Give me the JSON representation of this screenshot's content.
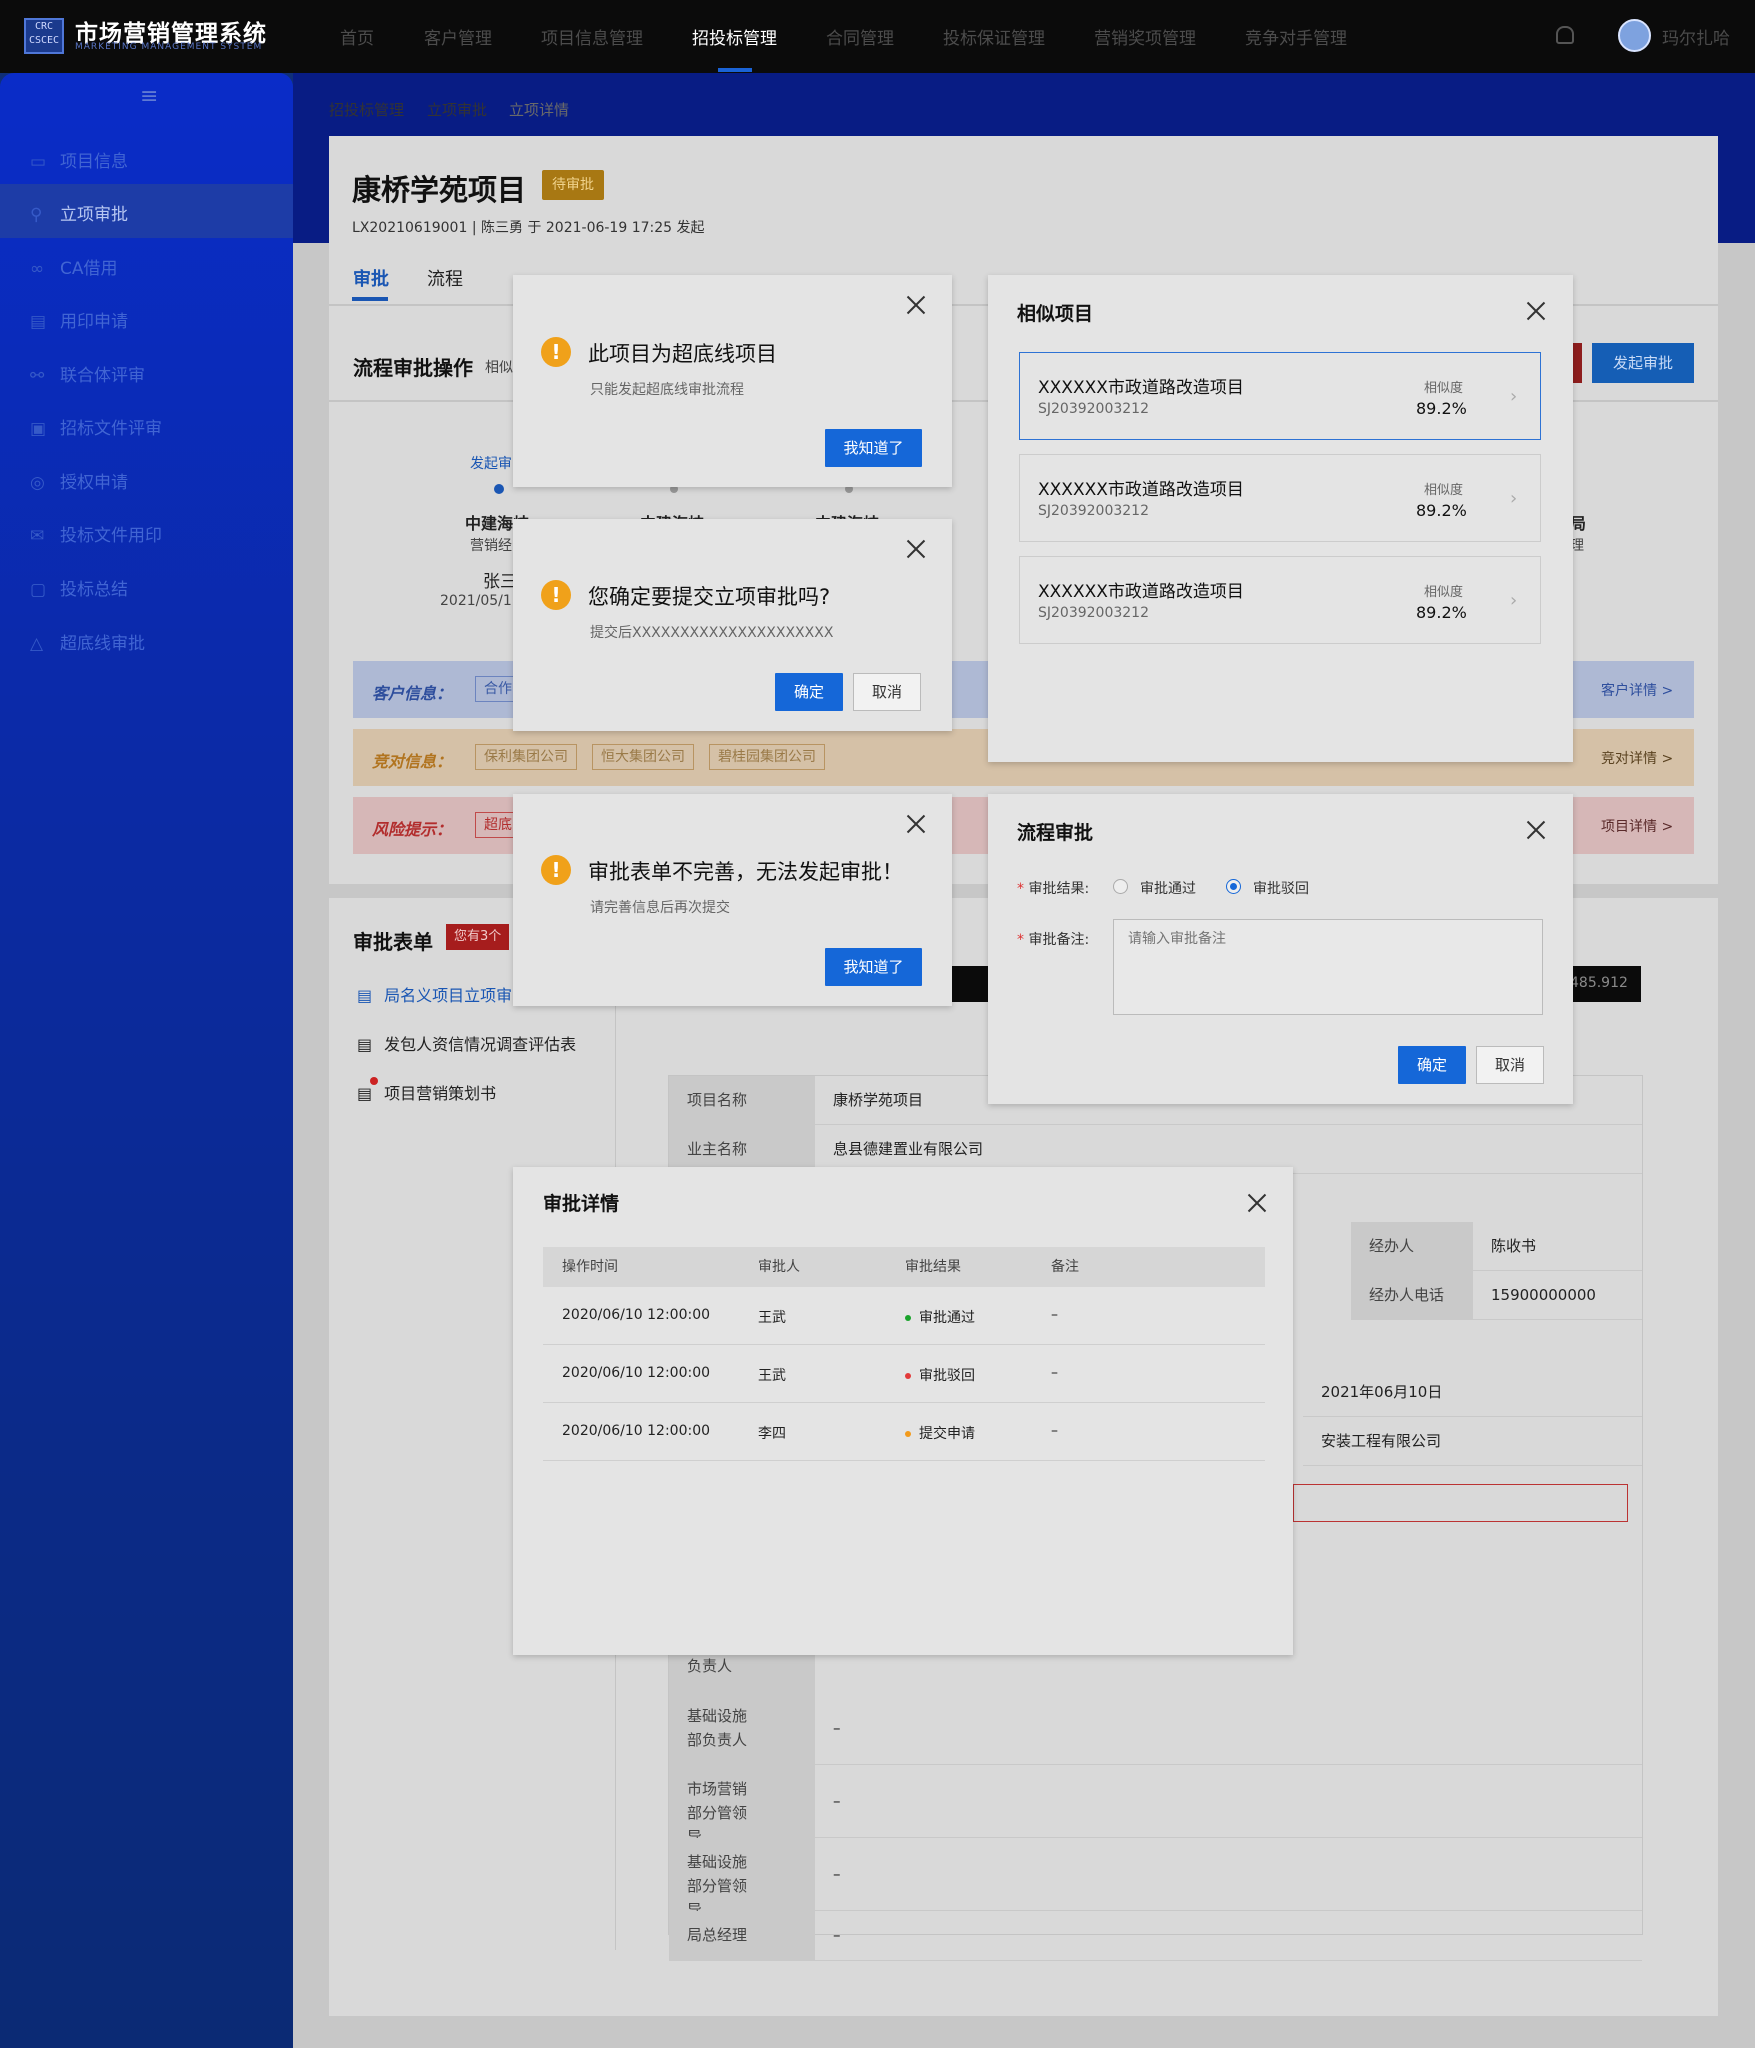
{
  "app": {
    "logo_text": "CRC CSCEC",
    "title": "市场营销管理系统",
    "subtitle": "MARKETING MANAGEMENT SYSTEM"
  },
  "nav": [
    "首页",
    "客户管理",
    "项目信息管理",
    "招投标管理",
    "合同管理",
    "投标保证管理",
    "营销奖项管理",
    "竞争对手管理"
  ],
  "user": {
    "name": "玛尔扎哈"
  },
  "sidebar": {
    "menu_icon": "≡",
    "items": [
      "项目信息",
      "立项审批",
      "CA借用",
      "用印申请",
      "联合体评审",
      "招标文件评审",
      "授权申请",
      "投标文件用印",
      "投标总结",
      "超底线审批"
    ]
  },
  "breadcrumb": [
    "招投标管理",
    "立项审批",
    "立项详情"
  ],
  "project": {
    "title": "康桥学苑项目",
    "status": "待审批",
    "meta": "LX20210619001  |  陈三勇 于 2021-06-19 17:25 发起"
  },
  "tabs": [
    "审批",
    "流程"
  ],
  "bg": {
    "flow_title": "流程审批操作",
    "flow_sub": "相似",
    "start_btn": "发起审批",
    "step_label": "发起审",
    "step_org_1": "中建海峡",
    "step_org_2": "中建海峡",
    "step_org_3": "中建海峡",
    "step_role": "营销经",
    "step_person": "张三",
    "step_date": "2021/05/1",
    "right_org": "局",
    "right_role": "理",
    "customer_label": "客户信息：",
    "customer_first": "合作",
    "customer_detail": "客户详情 >",
    "compete_label": "竞对信息：",
    "competitors": [
      "保利集团公司",
      "恒大集团公司",
      "碧桂园集团公司"
    ],
    "compete_detail": "竞对详情 >",
    "risk_label": "风险提示：",
    "risk_first": "超底",
    "risk_detail": "项目详情 >",
    "form_title": "审批表单",
    "form_badge": "您有3个",
    "forms": [
      "局名义项目立项审",
      "发包人资信情况调查评估表",
      "项目营销策划书"
    ],
    "amount": "485.912",
    "table": [
      {
        "label": "项目名称",
        "value": "康桥学苑项目"
      },
      {
        "label": "业主名称",
        "value": "息县德建置业有限公司"
      }
    ],
    "handler_label": "经办人",
    "handler_value": "陈收书",
    "handler_phone_label": "经办人电话",
    "handler_phone_value": "15900000000",
    "date_value": "2021年06月10日",
    "company_value": "安装工程有限公司",
    "approvers": [
      {
        "label": "负责人",
        "value": ""
      },
      {
        "label": "基础设施部负责人",
        "value": "–"
      },
      {
        "label": "市场营销部分管领导",
        "value": "–"
      },
      {
        "label": "基础设施部分管领导",
        "value": "–"
      },
      {
        "label": "局总经理",
        "value": "–"
      }
    ]
  },
  "dialog1": {
    "icon": "!",
    "title": "此项目为超底线项目",
    "desc": "只能发起超底线审批流程",
    "ok": "我知道了"
  },
  "dialog2": {
    "icon": "!",
    "title": "您确定要提交立项审批吗?",
    "desc": "提交后XXXXXXXXXXXXXXXXXXXXX",
    "confirm": "确定",
    "cancel": "取消"
  },
  "dialog3": {
    "icon": "!",
    "title": "审批表单不完善，无法发起审批！",
    "desc": "请完善信息后再次提交",
    "ok": "我知道了"
  },
  "similar": {
    "title": "相似项目",
    "items": [
      {
        "name": "XXXXXX市政道路改造项目",
        "code": "SJ20392003212",
        "label": "相似度",
        "value": "89.2%"
      },
      {
        "name": "XXXXXX市政道路改造项目",
        "code": "SJ20392003212",
        "label": "相似度",
        "value": "89.2%"
      },
      {
        "name": "XXXXXX市政道路改造项目",
        "code": "SJ20392003212",
        "label": "相似度",
        "value": "89.2%"
      }
    ]
  },
  "flow": {
    "title": "流程审批",
    "result_label": "审批结果:",
    "opt_pass": "审批通过",
    "opt_reject": "审批驳回",
    "selected": "审批驳回",
    "remark_label": "审批备注:",
    "remark_placeholder": "请输入审批备注",
    "confirm": "确定",
    "cancel": "取消"
  },
  "detail": {
    "title": "审批详情",
    "headers": [
      "操作时间",
      "审批人",
      "审批结果",
      "备注"
    ],
    "rows": [
      {
        "time": "2020/06/10 12:00:00",
        "person": "王武",
        "result": "审批通过",
        "color": "#19a32b",
        "note": "–"
      },
      {
        "time": "2020/06/10 12:00:00",
        "person": "王武",
        "result": "审批驳回",
        "color": "#e23a3a",
        "note": "–"
      },
      {
        "time": "2020/06/10 12:00:00",
        "person": "李四",
        "result": "提交申请",
        "color": "#f29a1b",
        "note": "–"
      }
    ]
  }
}
